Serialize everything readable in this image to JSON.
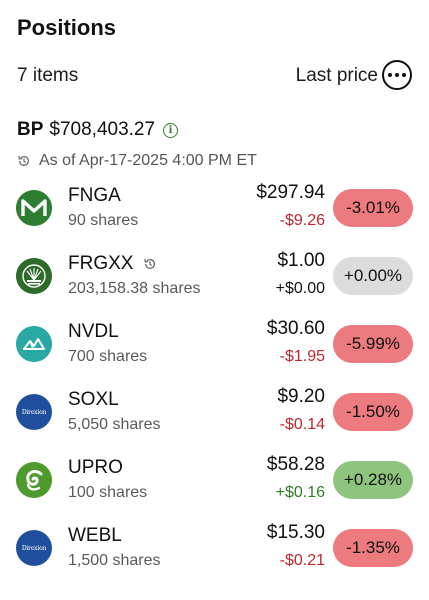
{
  "header": {
    "title": "Positions"
  },
  "subbar": {
    "items_count": "7 items",
    "sort_label": "Last price"
  },
  "balance": {
    "label": "BP",
    "value": "$708,403.27"
  },
  "asof": {
    "text": "As of Apr-17-2025 4:00 PM ET"
  },
  "colors": {
    "negative_text": "#c0262c",
    "positive_text": "#2f7d23",
    "pill_negative": "#ec7a7e",
    "pill_neutral": "#dcdcdc",
    "pill_positive": "#8fc47f",
    "accent_green": "#3a7d2c"
  },
  "positions": [
    {
      "ticker": "FNGA",
      "shares": "90 shares",
      "price": "$297.94",
      "change": "-$9.26",
      "percent": "-3.01%",
      "trend": "down",
      "logo_icon": "mm-logo-icon",
      "has_history_icon": false
    },
    {
      "ticker": "FRGXX",
      "shares": "203,158.38 shares",
      "price": "$1.00",
      "change": "+$0.00",
      "percent": "+0.00%",
      "trend": "flat",
      "logo_icon": "sunburst-logo-icon",
      "has_history_icon": true
    },
    {
      "ticker": "NVDL",
      "shares": "700 shares",
      "price": "$30.60",
      "change": "-$1.95",
      "percent": "-5.99%",
      "trend": "down",
      "logo_icon": "mountain-logo-icon",
      "has_history_icon": false
    },
    {
      "ticker": "SOXL",
      "shares": "5,050 shares",
      "price": "$9.20",
      "change": "-$0.14",
      "percent": "-1.50%",
      "trend": "down",
      "logo_icon": "direxion-logo-icon",
      "has_history_icon": false
    },
    {
      "ticker": "UPRO",
      "shares": "100 shares",
      "price": "$58.28",
      "change": "+$0.16",
      "percent": "+0.28%",
      "trend": "up",
      "logo_icon": "swirl-logo-icon",
      "has_history_icon": false
    },
    {
      "ticker": "WEBL",
      "shares": "1,500 shares",
      "price": "$15.30",
      "change": "-$0.21",
      "percent": "-1.35%",
      "trend": "down",
      "logo_icon": "direxion-logo-icon",
      "has_history_icon": false
    }
  ],
  "logo_text": {
    "direxion": "Direxion"
  }
}
